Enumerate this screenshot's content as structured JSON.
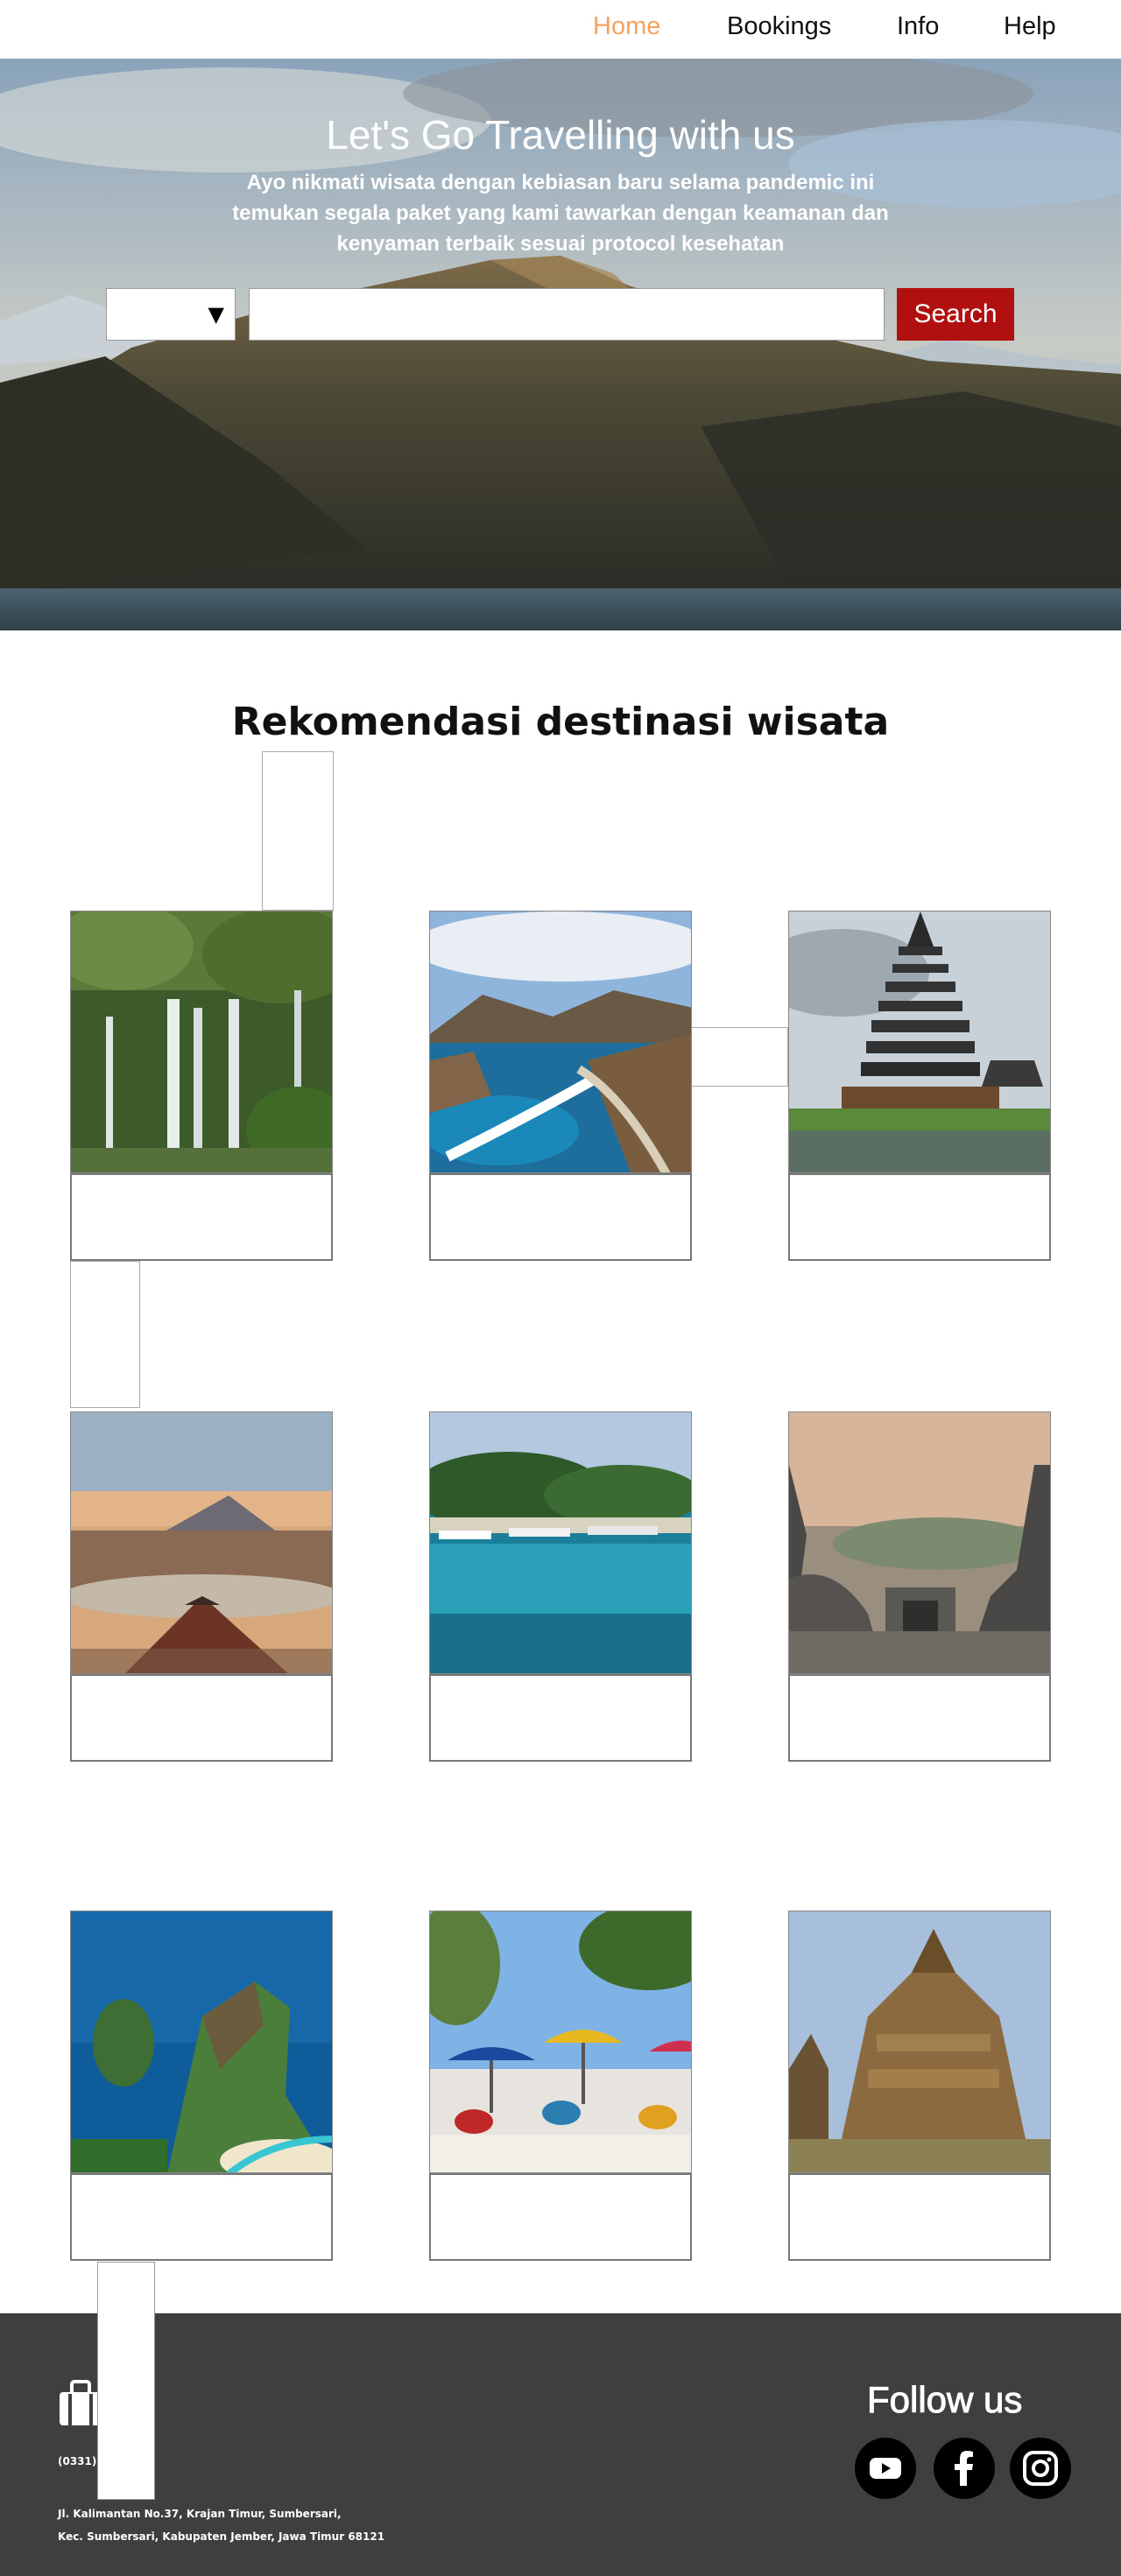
{
  "nav": {
    "home": "Home",
    "bookings": "Bookings",
    "info": "Info",
    "help": "Help",
    "active_color": "#f5a25d"
  },
  "hero": {
    "title": "Let's Go Travelling with us",
    "subtitle": "Ayo nikmati wisata dengan kebiasan baru selama pandemic ini temukan segala paket yang kami tawarkan dengan keamanan dan kenyaman terbaik sesuai protocol kesehatan",
    "select_value": "",
    "select_arrow": "▼",
    "search_value": "",
    "search_button": "Search",
    "button_color": "#b01010"
  },
  "recommendations": {
    "title": "Rekomendasi destinasi wisata",
    "cards": [
      {
        "image": "waterfall-photo",
        "caption": ""
      },
      {
        "image": "island-bay-photo",
        "caption": ""
      },
      {
        "image": "temple-pagoda-photo",
        "caption": ""
      },
      {
        "image": "volcano-photo",
        "caption": ""
      },
      {
        "image": "beach-boats-photo",
        "caption": ""
      },
      {
        "image": "stupa-temple-photo",
        "caption": ""
      },
      {
        "image": "cliff-coast-photo",
        "caption": ""
      },
      {
        "image": "beach-umbrellas-photo",
        "caption": ""
      },
      {
        "image": "hindu-temple-photo",
        "caption": ""
      }
    ]
  },
  "footer": {
    "icon": "briefcase-icon",
    "phone": "(0331) 3",
    "address_line1": "Jl. Kalimantan No.37, Krajan Timur, Sumbersari,",
    "address_line2": "Kec. Sumbersari, Kabupaten Jember, Jawa Timur 68121",
    "follow": "Follow us",
    "social": [
      "youtube-icon",
      "facebook-icon",
      "instagram-icon"
    ],
    "bg_color": "#3f3f3f"
  }
}
